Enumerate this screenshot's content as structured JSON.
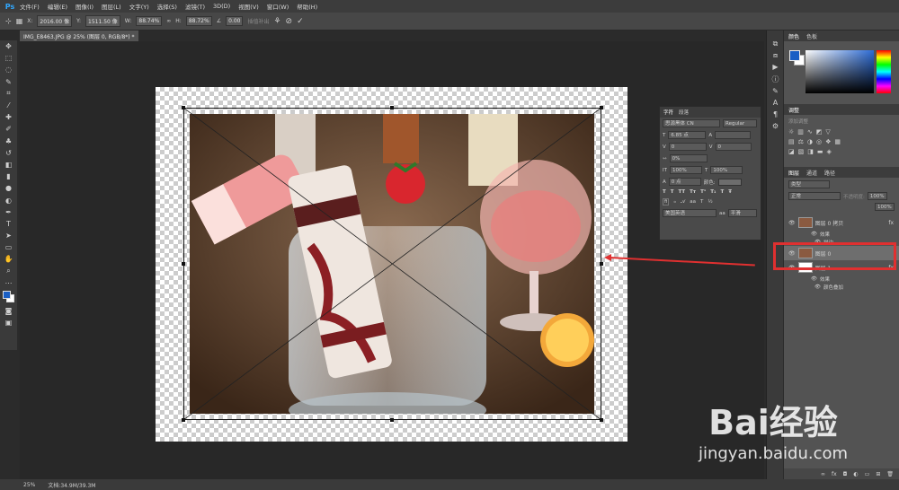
{
  "app": {
    "logo": "Ps"
  },
  "menu": [
    "文件(F)",
    "编辑(E)",
    "图像(I)",
    "图层(L)",
    "文字(Y)",
    "选择(S)",
    "滤镜(T)",
    "3D(D)",
    "视图(V)",
    "窗口(W)",
    "帮助(H)"
  ],
  "options": {
    "x_label": "X:",
    "x_value": "2016.00 像",
    "y_label": "Y:",
    "y_value": "1511.50 像",
    "w_label": "W:",
    "w_value": "88.74%",
    "h_label": "H:",
    "h_value": "88.72%",
    "angle_value": "0.00",
    "warp_label": "插值补出"
  },
  "document": {
    "tab_title": "IMG_E8463.JPG @ 25% (图层 0, RGB/8*) *"
  },
  "character_panel": {
    "tabs": [
      "字符",
      "段落"
    ],
    "font_family": "思源黑体 CN",
    "font_style": "Regular",
    "font_size": "6.85 点",
    "leading": "0",
    "tracking": "0",
    "scale": "0%",
    "vscale": "100%",
    "hscale": "100%",
    "baseline": "0 点",
    "color_label": "颜色:",
    "language": "美国英语",
    "antialias": "平滑"
  },
  "color_panel": {
    "tabs": [
      "颜色",
      "色板"
    ]
  },
  "adjust_panel": {
    "tabs": [
      "调整"
    ],
    "title": "添加调整"
  },
  "layers_panel": {
    "tabs": [
      "图层",
      "通道",
      "路径"
    ],
    "filter_label": "类型",
    "blend_mode": "正常",
    "opacity_label": "不透明度:",
    "opacity_value": "100%",
    "fill_value": "100%",
    "layers": [
      {
        "name": "图层 0 拷贝",
        "fx": "fx"
      },
      {
        "name": "图层 0",
        "fx": ""
      },
      {
        "name": "图层 1",
        "fx": "fx"
      }
    ],
    "effects": [
      {
        "name": "效果"
      },
      {
        "name": "描边"
      },
      {
        "name": "效果"
      },
      {
        "name": "颜色叠加"
      }
    ]
  },
  "status": {
    "zoom": "25%",
    "doc_info": "文档:34.9M/39.3M"
  },
  "watermark": {
    "brand": "Bai经验",
    "url": "jingyan.baidu.com"
  },
  "colors": {
    "foreground": "#1a5fc4",
    "background": "#ffffff",
    "accent": "#e03030",
    "ps_blue": "#31a8ff"
  }
}
